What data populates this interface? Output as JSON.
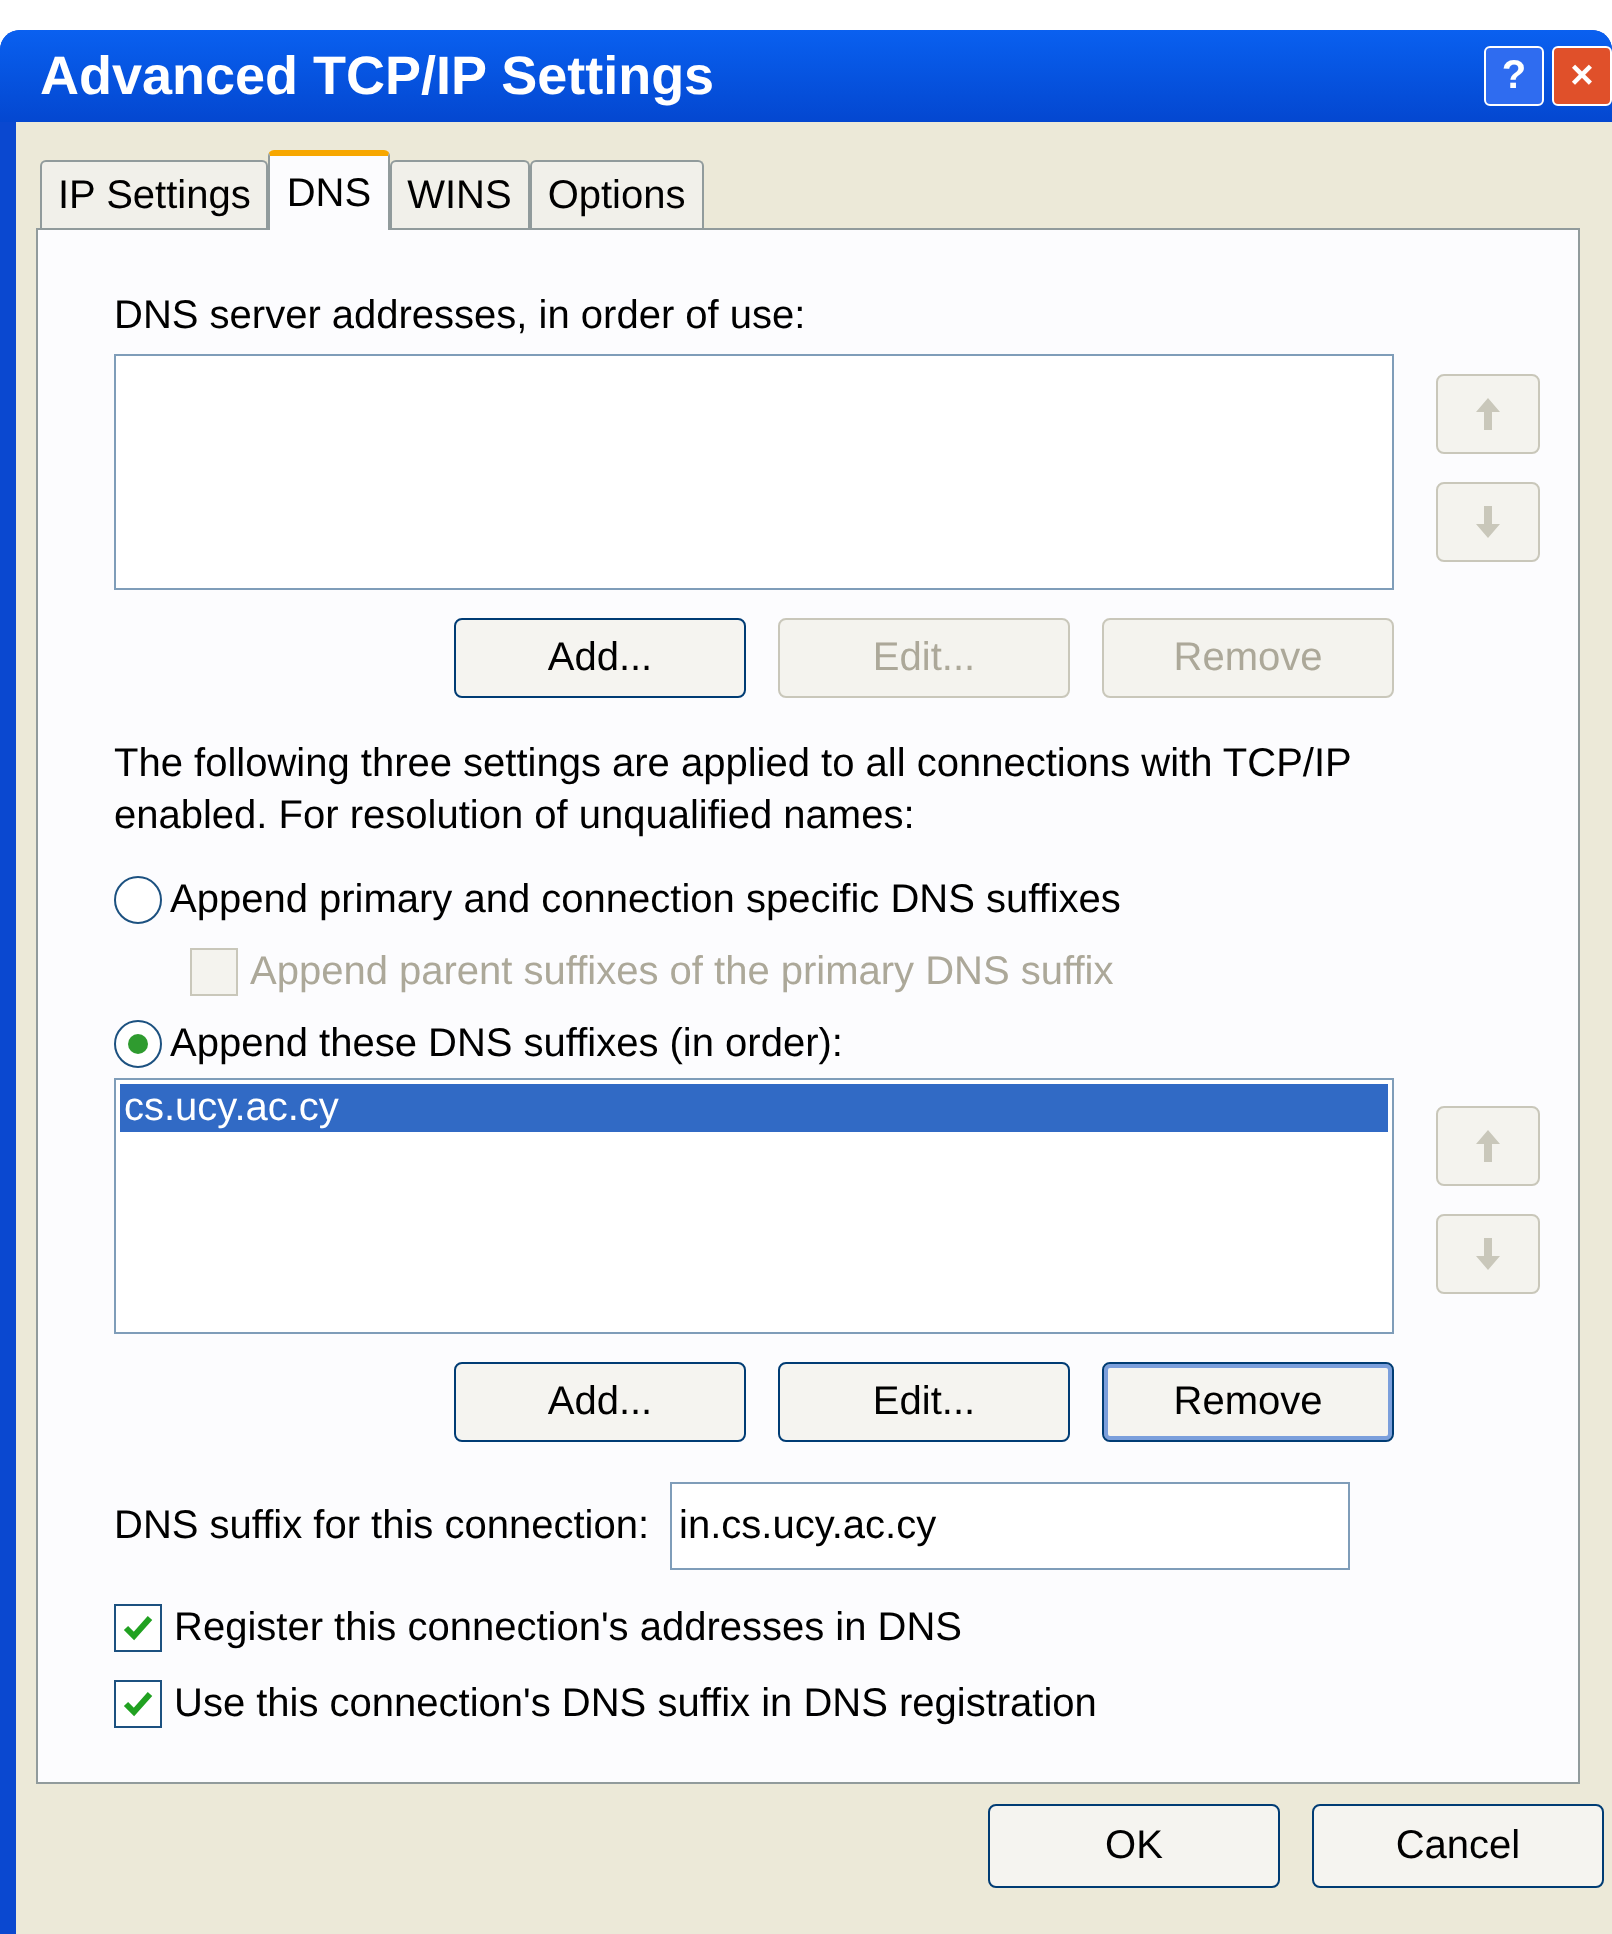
{
  "window": {
    "title": "Advanced TCP/IP Settings"
  },
  "title_buttons": [
    {
      "kind": "help",
      "label": "?"
    },
    {
      "kind": "close",
      "label": "×"
    }
  ],
  "tabs": [
    {
      "label": "IP Settings",
      "selected": false
    },
    {
      "label": "DNS",
      "selected": true
    },
    {
      "label": "WINS",
      "selected": false
    },
    {
      "label": "Options",
      "selected": false
    }
  ],
  "dns_servers": {
    "label": "DNS server addresses, in order of use:",
    "arrows": [
      {
        "kind": "up",
        "disabled": true
      },
      {
        "kind": "down",
        "disabled": true
      }
    ],
    "buttons": [
      {
        "label": "Add...",
        "disabled": false,
        "focused": false
      },
      {
        "label": "Edit...",
        "disabled": true,
        "focused": false
      },
      {
        "label": "Remove",
        "disabled": true,
        "focused": false
      }
    ]
  },
  "description": "The following three settings are applied to all connections with TCP/IP enabled. For resolution of unqualified names:",
  "options": [
    {
      "kind": "radio",
      "label": "Append primary and connection specific DNS suffixes",
      "selected": false,
      "children": [
        {
          "kind": "checkbox",
          "label": "Append parent suffixes of the primary DNS suffix",
          "checked": false,
          "disabled": true
        }
      ]
    },
    {
      "kind": "radio",
      "label": "Append these DNS suffixes (in order):",
      "selected": true
    }
  ],
  "suffixes": {
    "items": [
      {
        "text": "cs.ucy.ac.cy",
        "selected": true
      }
    ],
    "arrows": [
      {
        "kind": "up",
        "disabled": true
      },
      {
        "kind": "down",
        "disabled": true
      }
    ],
    "buttons": [
      {
        "label": "Add...",
        "disabled": false,
        "focused": false
      },
      {
        "label": "Edit...",
        "disabled": false,
        "focused": false
      },
      {
        "label": "Remove",
        "disabled": false,
        "focused": true
      }
    ]
  },
  "connection_suffix": {
    "label": "DNS suffix for this connection:",
    "value": "in.cs.ucy.ac.cy"
  },
  "checkboxes": [
    {
      "label": "Register this connection's addresses in DNS",
      "checked": true
    },
    {
      "label": "Use this connection's DNS suffix in DNS registration",
      "checked": true
    }
  ],
  "footer_buttons": [
    {
      "label": "OK"
    },
    {
      "label": "Cancel"
    }
  ]
}
